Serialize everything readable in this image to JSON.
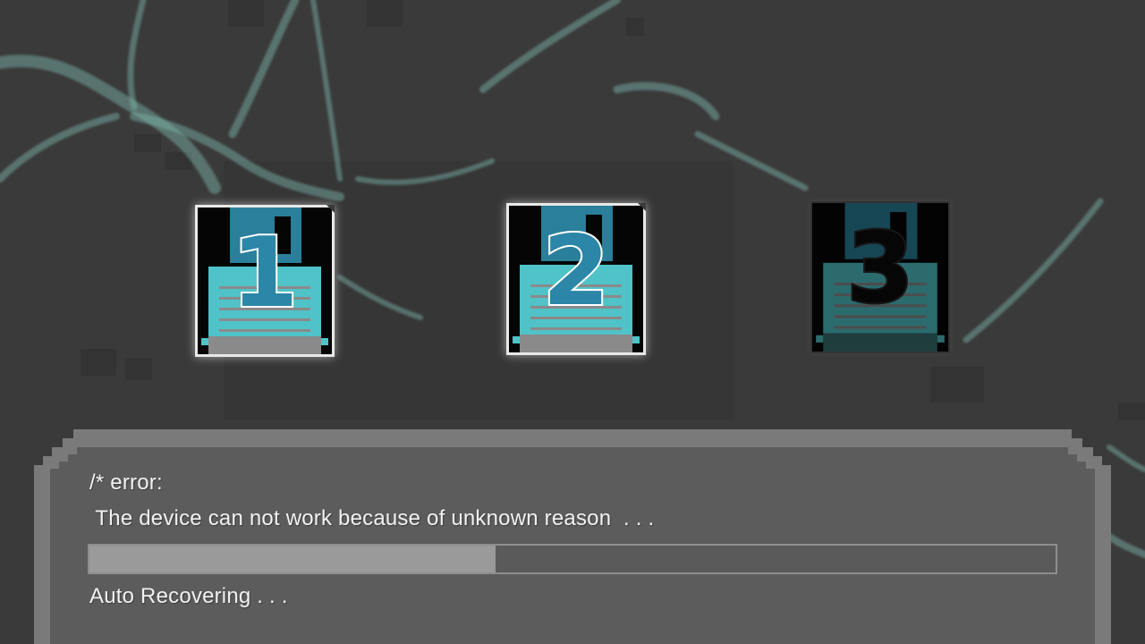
{
  "slots": [
    {
      "number": "1",
      "state": "available",
      "color": "#2c86a8"
    },
    {
      "number": "2",
      "state": "available",
      "color": "#2c86a8"
    },
    {
      "number": "3",
      "state": "locked",
      "color": "#0a0a0a"
    }
  ],
  "dialog": {
    "error_label": "/* error:",
    "error_message": " The device can not work because of unknown reason  . . .",
    "progress": 0.42,
    "status_label": "Auto Recovering . . ."
  },
  "colors": {
    "background": "#3a3a3a",
    "panel": "#5a5a5a",
    "disk_teal": "#4fc3c8",
    "disk_blue": "#2c86a8",
    "progress_fill": "#9a9a9a"
  }
}
